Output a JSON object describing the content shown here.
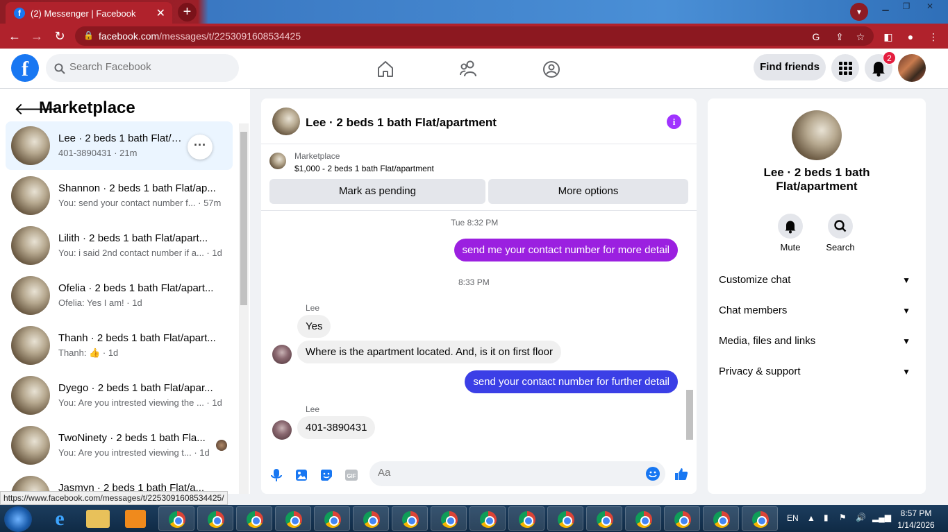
{
  "browser": {
    "tab_title": "(2) Messenger | Facebook",
    "url_host": "facebook.com",
    "url_path": "/messages/t/2253091608534425",
    "status_url": "https://www.facebook.com/messages/t/2253091608534425/"
  },
  "fb": {
    "search_placeholder": "Search Facebook",
    "find_friends": "Find friends",
    "notif_count": "2"
  },
  "sidebar": {
    "title": "Marketplace",
    "conversations": [
      {
        "name": "Lee · 2 beds 1 bath Flat/apartment",
        "snippet": "401-3890431 · 21m"
      },
      {
        "name": "Shannon · 2 beds 1 bath Flat/ap...",
        "snippet": "You: send your contact number f... · 57m"
      },
      {
        "name": "Lilith · 2 beds 1 bath Flat/apart...",
        "snippet": "You: i said 2nd contact number if a... · 1d"
      },
      {
        "name": "Ofelia · 2 beds 1 bath Flat/apart...",
        "snippet": "Ofelia: Yes I am! · 1d"
      },
      {
        "name": "Thanh · 2 beds 1 bath Flat/apart...",
        "snippet": "Thanh: 👍 · 1d"
      },
      {
        "name": "Dyego · 2 beds 1 bath Flat/apar...",
        "snippet": "You: Are you intrested viewing the ... · 1d"
      },
      {
        "name": "TwoNinety · 2 beds 1 bath Fla...",
        "snippet": "You: Are you intrested viewing t... · 1d"
      },
      {
        "name": "Jasmyn · 2 beds 1 bath Flat/a...",
        "snippet": ""
      }
    ]
  },
  "chat": {
    "title": "Lee · 2 beds 1 bath Flat/apartment",
    "listing_source": "Marketplace",
    "listing_price": "$1,000 - 2 beds 1 bath Flat/apartment",
    "mark_pending": "Mark as pending",
    "more_options": "More options",
    "time1": "Tue 8:32 PM",
    "msg_out1": "send me your contact number for more detail",
    "time2": "8:33 PM",
    "sender": "Lee",
    "msg_in1": "Yes",
    "msg_in2": "Where is the apartment located. And, is it on first floor",
    "msg_out2": "send your contact number for further detail",
    "msg_in3": "401-3890431",
    "composer_placeholder": "Aa",
    "colors": {
      "out1": "#9b20e0",
      "out2": "#3b3fe6",
      "accent": "#a033ff"
    }
  },
  "info_panel": {
    "name": "Lee · 2 beds 1 bath Flat/apartment",
    "mute": "Mute",
    "search": "Search",
    "sections": [
      "Customize chat",
      "Chat members",
      "Media, files and links",
      "Privacy & support"
    ]
  },
  "taskbar": {
    "lang": "EN",
    "time": "8:57 PM",
    "date": "1/14/2026"
  }
}
